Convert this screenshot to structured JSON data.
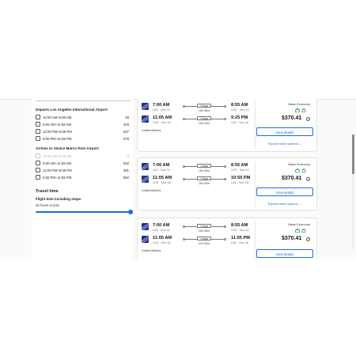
{
  "filters": {
    "departs_title": "Departs Los Angeles International Airport",
    "departs": [
      {
        "label": "12:00 AM–5:59 AM",
        "count": "29"
      },
      {
        "label": "6:00 AM–11:59 AM",
        "count": "403"
      },
      {
        "label": "12:00 PM–5:59 PM",
        "count": "537"
      },
      {
        "label": "6:00 PM–11:59 PM",
        "count": "376"
      }
    ],
    "arrives_title": "Arrives to Venice Marco Polo Airport",
    "arrives": [
      {
        "label": "12:00 AM–5:59 AM",
        "count": "0"
      },
      {
        "label": "6:00 AM–11:59 AM",
        "count": "332"
      },
      {
        "label": "12:00 PM–5:59 PM",
        "count": "491"
      },
      {
        "label": "6:00 PM–11:59 PM",
        "count": "552"
      }
    ],
    "travel_time_title": "Travel time",
    "flight_time_label": "Flight time including stops",
    "flight_time_value": "45 hours or less",
    "flight_time_fraction": 1.0
  },
  "results": [
    {
      "outbound": {
        "dep_time": "7:00 AM",
        "dep_sub": "LAX · Nov 11",
        "stops": "1 stop",
        "duration": "16h 55m",
        "arr_time": "8:55 AM",
        "arr_sub": "VCE · Nov 12"
      },
      "return": {
        "dep_time": "11:05 AM",
        "dep_sub": "VCE · Nov 18",
        "stops": "1 stop",
        "duration": "19h 20m",
        "arr_time": "9:25 PM",
        "arr_sub": "LAX · Nov 18"
      },
      "airline": "United Airlines",
      "cabin": "Basic Economy",
      "price": "$370.41",
      "button": "View details",
      "options": "Explore ticket options"
    },
    {
      "outbound": {
        "dep_time": "7:00 AM",
        "dep_sub": "LAX · Nov 11",
        "stops": "1 stop",
        "duration": "16h 55m",
        "arr_time": "8:55 AM",
        "arr_sub": "VCE · Nov 12"
      },
      "return": {
        "dep_time": "11:05 AM",
        "dep_sub": "VCE · Nov 18",
        "stops": "1 stop",
        "duration": "20h 50m",
        "arr_time": "10:55 PM",
        "arr_sub": "LAX · Nov 18"
      },
      "airline": "United Airlines",
      "cabin": "Basic Economy",
      "price": "$370.41",
      "button": "View details",
      "options": "Explore ticket options"
    },
    {
      "outbound": {
        "dep_time": "7:00 AM",
        "dep_sub": "LAX · Nov 11",
        "stops": "1 stop",
        "duration": "16h 55m",
        "arr_time": "8:55 AM",
        "arr_sub": "VCE · Nov 12"
      },
      "return": {
        "dep_time": "11:05 AM",
        "dep_sub": "VCE · Nov 18",
        "stops": "1 stop",
        "duration": "21h 50m",
        "arr_time": "11:55 PM",
        "arr_sub": "LAX · Nov 18"
      },
      "airline": "United Airlines",
      "cabin": "Basic Economy",
      "price": "$370.41",
      "button": "View details",
      "options": ""
    }
  ],
  "colors": {
    "accent": "#1e6ad8",
    "amenity": "#2a8a3e",
    "airline_logo": "#1e2e8c"
  }
}
